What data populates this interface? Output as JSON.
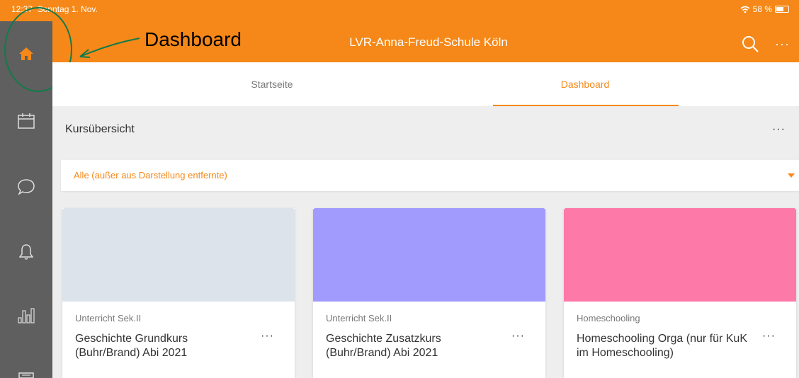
{
  "status": {
    "time": "12:37",
    "date": "Sonntag 1. Nov.",
    "battery": "58 %"
  },
  "annotation": {
    "label": "Dashboard",
    "color": "#127a4b"
  },
  "header": {
    "title": "LVR-Anna-Freud-Schule Köln",
    "more": "···",
    "color": "#f58818"
  },
  "sidebar": {
    "items": [
      {
        "icon": "home-icon"
      },
      {
        "icon": "calendar-icon"
      },
      {
        "icon": "chat-icon"
      },
      {
        "icon": "bell-icon"
      },
      {
        "icon": "chart-icon"
      },
      {
        "icon": "news-icon"
      }
    ]
  },
  "tabs": [
    {
      "label": "Startseite",
      "active": false
    },
    {
      "label": "Dashboard",
      "active": true
    }
  ],
  "section": {
    "title": "Kursübersicht",
    "more": "···"
  },
  "filter": {
    "value": "Alle (außer aus Darstellung entfernte)"
  },
  "courses": [
    {
      "category": "Unterricht Sek.II",
      "title": "Geschichte Grundkurs (Buhr/Brand) Abi 2021",
      "color": "#dde3ea",
      "more": "···"
    },
    {
      "category": "Unterricht Sek.II",
      "title": "Geschichte Zusatzkurs (Buhr/Brand) Abi 2021",
      "color": "#a29bfe",
      "more": "···"
    },
    {
      "category": "Homeschooling",
      "title": "Homeschooling Orga (nur für KuK im Homeschooling)",
      "color": "#fd79a8",
      "more": "···"
    }
  ]
}
